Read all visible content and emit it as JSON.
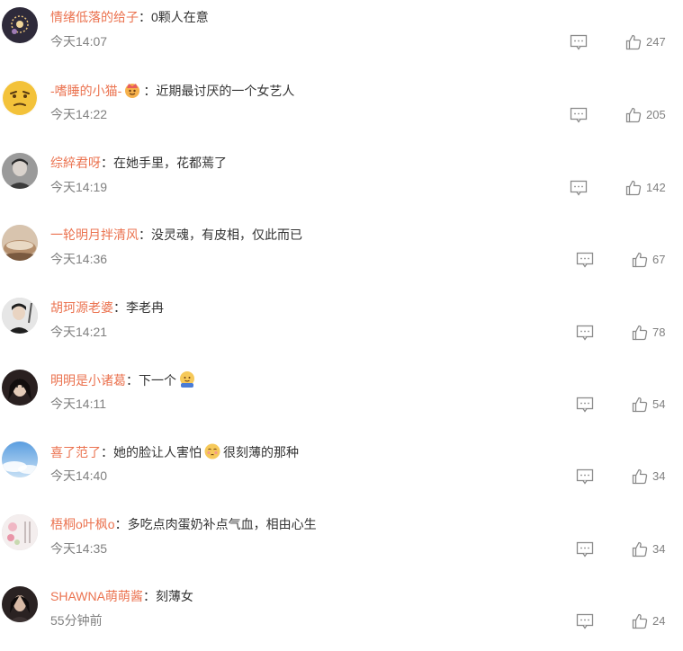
{
  "comments": [
    {
      "user": "情绪低落的给子",
      "separator": "：",
      "text": "0颗人在意",
      "text2": "",
      "time": "今天14:07",
      "likes": "247",
      "avatar": "fireworks-avatar",
      "avatar_color": "#2e2a3a"
    },
    {
      "user": "-嗜睡的小猫-",
      "separator": "：",
      "text": "近期最讨厌的一个女艺人",
      "text2": "",
      "time": "今天14:22",
      "likes": "205",
      "avatar": "emoji-thinking-avatar",
      "avatar_color": "#f3c23a"
    },
    {
      "user": "综綷君呀",
      "separator": "：",
      "text": "在她手里，花都蔫了",
      "text2": "",
      "time": "今天14:19",
      "likes": "142",
      "avatar": "person-avatar",
      "avatar_color": "#6e6e6e"
    },
    {
      "user": "一轮明月拌清风",
      "separator": "：",
      "text": "没灵魂，有皮相，仅此而已",
      "text2": "",
      "time": "今天14:36",
      "likes": "67",
      "avatar": "bowl-avatar",
      "avatar_color": "#c9a98c"
    },
    {
      "user": "胡珂源老婆",
      "separator": "：",
      "text": "李老冉",
      "text2": "",
      "time": "今天14:21",
      "likes": "78",
      "avatar": "person-avatar",
      "avatar_color": "#d8d8d8"
    },
    {
      "user": "明明是小诸葛",
      "separator": "：",
      "text": "下一个",
      "text2": "",
      "time": "今天14:11",
      "likes": "54",
      "avatar": "person-avatar",
      "avatar_color": "#3a2e2a"
    },
    {
      "user": "喜了范了",
      "separator": "：",
      "text": "她的脸让人害怕",
      "text2": "很刻薄的那种",
      "time": "今天14:40",
      "likes": "34",
      "avatar": "sky-avatar",
      "avatar_color": "#7fb2e5"
    },
    {
      "user": "梧桐o叶枫o",
      "separator": "：",
      "text": "多吃点肉蛋奶补点气血，相由心生",
      "text2": "",
      "time": "今天14:35",
      "likes": "34",
      "avatar": "flower-avatar",
      "avatar_color": "#efe6e6"
    },
    {
      "user": "SHAWNA萌萌酱",
      "separator": "：",
      "text": "刻薄女",
      "text2": "",
      "time": "55分钟前",
      "likes": "24",
      "avatar": "person-avatar",
      "avatar_color": "#2a2222"
    }
  ],
  "icons": {
    "reply": "comment-icon",
    "like": "thumb-up-icon"
  },
  "colors": {
    "username": "#eb7350",
    "text": "#333333",
    "meta": "#808080"
  }
}
